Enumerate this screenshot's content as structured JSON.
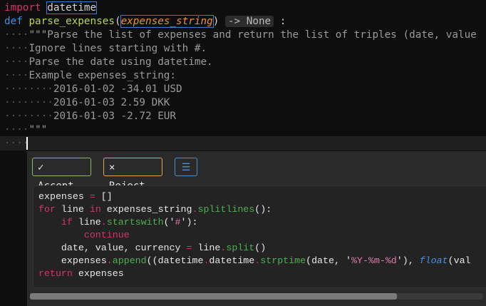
{
  "editor": {
    "lines": [
      [
        [
          "import",
          "kw"
        ],
        [
          " ",
          "ws"
        ],
        [
          "datetime",
          "box"
        ]
      ],
      [
        [
          "def",
          "def"
        ],
        [
          " ",
          "ws"
        ],
        [
          "parse_expenses",
          "fn"
        ],
        [
          "(",
          ""
        ],
        [
          "expenses_string",
          "param box"
        ],
        [
          ")",
          ""
        ],
        [
          " ",
          ""
        ],
        [
          "-> None",
          "hint"
        ],
        [
          " :",
          ""
        ]
      ],
      [
        [
          "····",
          "ws"
        ],
        [
          "\"\"\"Parse the list of expenses and return the list of triples (date, value",
          "doc"
        ]
      ],
      [
        [
          "····",
          "ws"
        ],
        [
          "Ignore lines starting with #.",
          "doc"
        ]
      ],
      [
        [
          "····",
          "ws"
        ],
        [
          "Parse the date using datetime.",
          "doc"
        ]
      ],
      [
        [
          "····",
          "ws"
        ],
        [
          "Example expenses_string:",
          "doc"
        ]
      ],
      [
        [
          "········",
          "ws"
        ],
        [
          "2016-01-02 -34.01 USD",
          "doc"
        ]
      ],
      [
        [
          "········",
          "ws"
        ],
        [
          "2016-01-03 2.59 DKK",
          "doc"
        ]
      ],
      [
        [
          "········",
          "ws"
        ],
        [
          "2016-01-03 -2.72 EUR",
          "doc"
        ]
      ],
      [
        [
          "····",
          "ws"
        ],
        [
          "\"\"\"",
          "doc"
        ]
      ],
      [
        [
          "····",
          "ws"
        ]
      ]
    ]
  },
  "suggestion": {
    "accept_label": "✓ Accept",
    "reject_label": "× Reject",
    "menu_icon": "☰",
    "scroll_fraction": 0.81,
    "lines": [
      [
        [
          "expenses ",
          ""
        ],
        [
          "=",
          "sk"
        ],
        [
          " []",
          ""
        ]
      ],
      [
        [
          "for",
          "sk"
        ],
        [
          " line ",
          ""
        ],
        [
          "in",
          "sk"
        ],
        [
          " expenses_string",
          ""
        ],
        [
          ".",
          "sk"
        ],
        [
          "splitlines",
          "sm"
        ],
        [
          "():",
          ""
        ]
      ],
      [
        [
          "    ",
          ""
        ],
        [
          "if",
          "sk"
        ],
        [
          " line",
          ""
        ],
        [
          ".",
          "sk"
        ],
        [
          "startswith",
          "sm"
        ],
        [
          "('",
          ""
        ],
        [
          "#",
          "ss"
        ],
        [
          "'):",
          ""
        ]
      ],
      [
        [
          "        ",
          ""
        ],
        [
          "continue",
          "sk"
        ]
      ],
      [
        [
          "    date, value, currency ",
          ""
        ],
        [
          "=",
          "sk"
        ],
        [
          " line",
          ""
        ],
        [
          ".",
          "sk"
        ],
        [
          "split",
          "sm"
        ],
        [
          "()",
          ""
        ]
      ],
      [
        [
          "    expenses",
          ""
        ],
        [
          ".",
          "sk"
        ],
        [
          "append",
          "sm"
        ],
        [
          "((datetime",
          ""
        ],
        [
          ".",
          "sk"
        ],
        [
          "datetime",
          ""
        ],
        [
          ".",
          "sk"
        ],
        [
          "strptime",
          "sm"
        ],
        [
          "(date, '",
          ""
        ],
        [
          "%Y-%m-%d",
          "ss"
        ],
        [
          "'), ",
          ""
        ],
        [
          "float",
          "sf"
        ],
        [
          "(val",
          ""
        ]
      ],
      [
        [
          "return",
          "sk"
        ],
        [
          " expenses",
          ""
        ]
      ]
    ]
  }
}
